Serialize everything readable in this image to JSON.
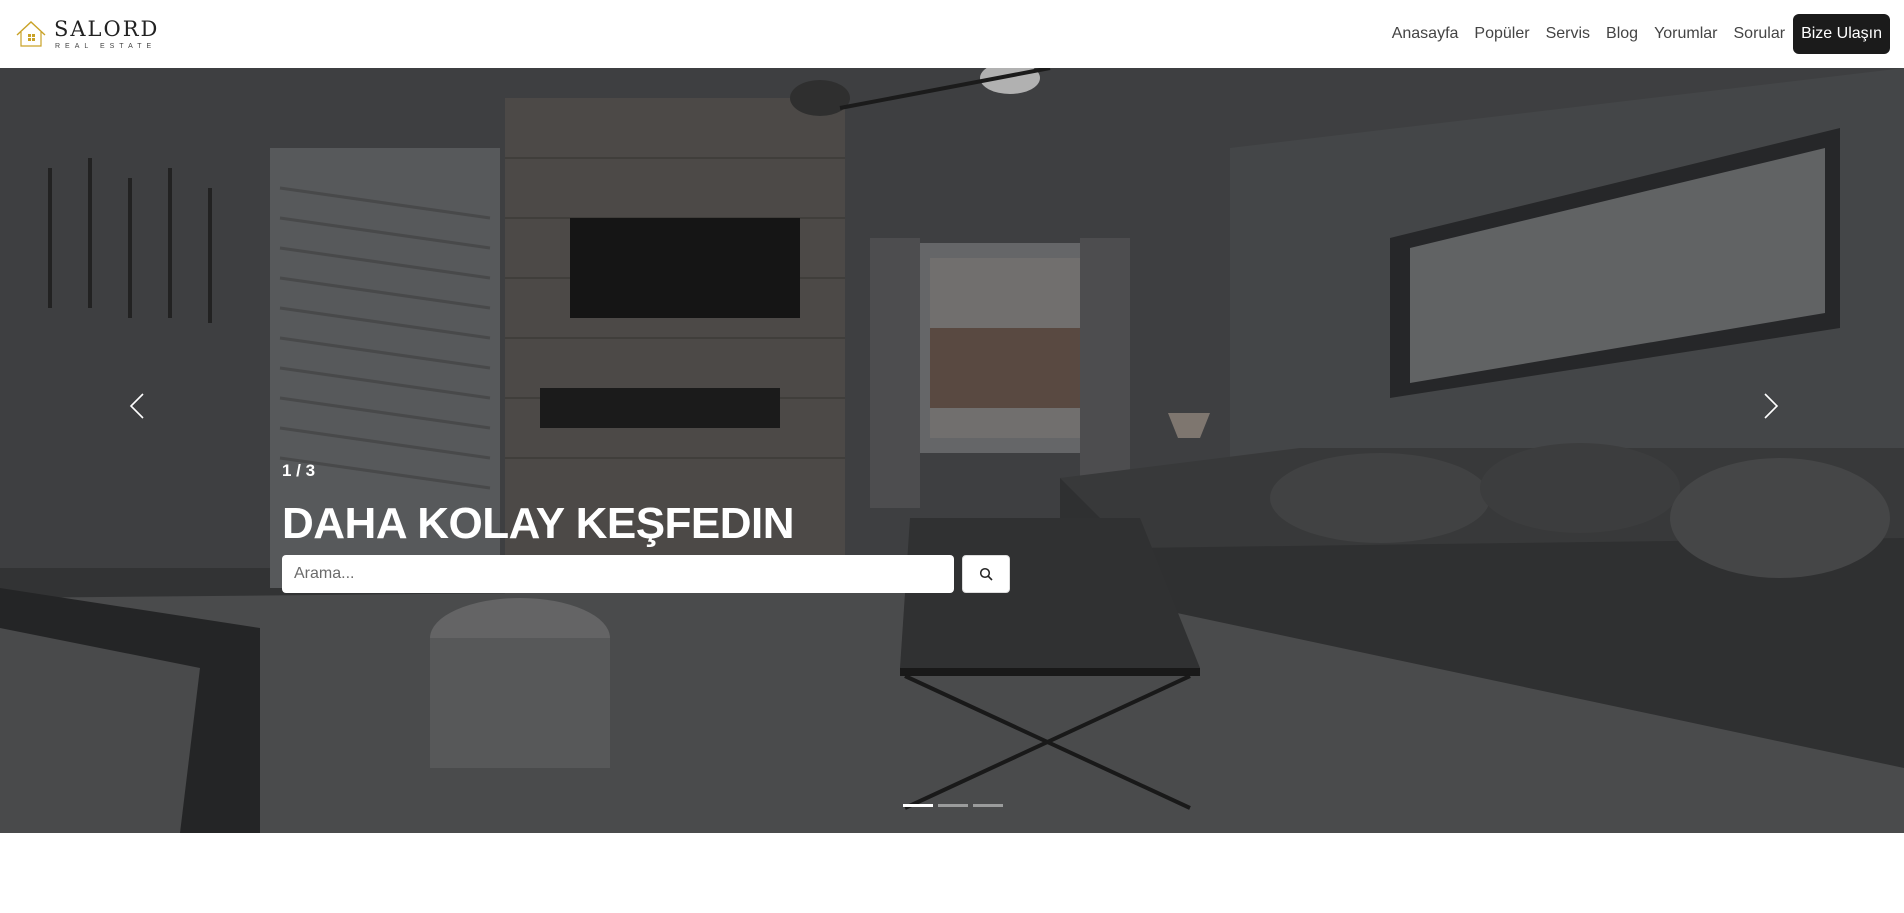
{
  "brand": {
    "name": "SALORD",
    "tagline": "REAL ESTATE",
    "accent_color": "#c9a227"
  },
  "nav": {
    "items": [
      {
        "label": "Anasayfa"
      },
      {
        "label": "Popüler"
      },
      {
        "label": "Servis"
      },
      {
        "label": "Blog"
      },
      {
        "label": "Yorumlar"
      },
      {
        "label": "Sorular"
      }
    ],
    "cta_label": "Bize Ulaşın"
  },
  "hero": {
    "counter": "1 / 3",
    "headline": "DAHA KOLAY KEŞFEDIN",
    "search_placeholder": "Arama...",
    "search_value": "",
    "search_button_icon": "search-icon",
    "prev_icon": "chevron-left-icon",
    "next_icon": "chevron-right-icon",
    "slides_total": 3,
    "active_slide": 1
  }
}
